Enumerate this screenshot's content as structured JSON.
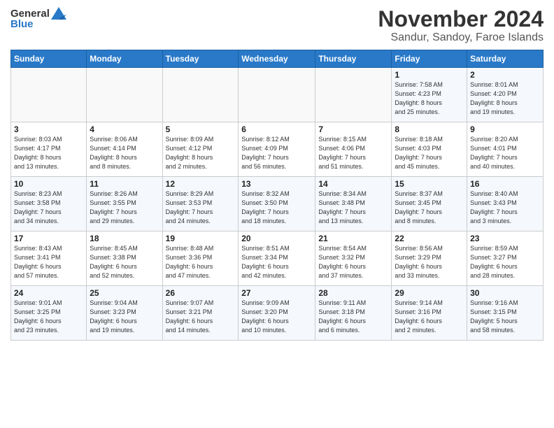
{
  "header": {
    "logo_general": "General",
    "logo_blue": "Blue",
    "month_title": "November 2024",
    "location": "Sandur, Sandoy, Faroe Islands"
  },
  "calendar": {
    "days_of_week": [
      "Sunday",
      "Monday",
      "Tuesday",
      "Wednesday",
      "Thursday",
      "Friday",
      "Saturday"
    ],
    "weeks": [
      [
        {
          "date": "",
          "info": ""
        },
        {
          "date": "",
          "info": ""
        },
        {
          "date": "",
          "info": ""
        },
        {
          "date": "",
          "info": ""
        },
        {
          "date": "",
          "info": ""
        },
        {
          "date": "1",
          "info": "Sunrise: 7:58 AM\nSunset: 4:23 PM\nDaylight: 8 hours\nand 25 minutes."
        },
        {
          "date": "2",
          "info": "Sunrise: 8:01 AM\nSunset: 4:20 PM\nDaylight: 8 hours\nand 19 minutes."
        }
      ],
      [
        {
          "date": "3",
          "info": "Sunrise: 8:03 AM\nSunset: 4:17 PM\nDaylight: 8 hours\nand 13 minutes."
        },
        {
          "date": "4",
          "info": "Sunrise: 8:06 AM\nSunset: 4:14 PM\nDaylight: 8 hours\nand 8 minutes."
        },
        {
          "date": "5",
          "info": "Sunrise: 8:09 AM\nSunset: 4:12 PM\nDaylight: 8 hours\nand 2 minutes."
        },
        {
          "date": "6",
          "info": "Sunrise: 8:12 AM\nSunset: 4:09 PM\nDaylight: 7 hours\nand 56 minutes."
        },
        {
          "date": "7",
          "info": "Sunrise: 8:15 AM\nSunset: 4:06 PM\nDaylight: 7 hours\nand 51 minutes."
        },
        {
          "date": "8",
          "info": "Sunrise: 8:18 AM\nSunset: 4:03 PM\nDaylight: 7 hours\nand 45 minutes."
        },
        {
          "date": "9",
          "info": "Sunrise: 8:20 AM\nSunset: 4:01 PM\nDaylight: 7 hours\nand 40 minutes."
        }
      ],
      [
        {
          "date": "10",
          "info": "Sunrise: 8:23 AM\nSunset: 3:58 PM\nDaylight: 7 hours\nand 34 minutes."
        },
        {
          "date": "11",
          "info": "Sunrise: 8:26 AM\nSunset: 3:55 PM\nDaylight: 7 hours\nand 29 minutes."
        },
        {
          "date": "12",
          "info": "Sunrise: 8:29 AM\nSunset: 3:53 PM\nDaylight: 7 hours\nand 24 minutes."
        },
        {
          "date": "13",
          "info": "Sunrise: 8:32 AM\nSunset: 3:50 PM\nDaylight: 7 hours\nand 18 minutes."
        },
        {
          "date": "14",
          "info": "Sunrise: 8:34 AM\nSunset: 3:48 PM\nDaylight: 7 hours\nand 13 minutes."
        },
        {
          "date": "15",
          "info": "Sunrise: 8:37 AM\nSunset: 3:45 PM\nDaylight: 7 hours\nand 8 minutes."
        },
        {
          "date": "16",
          "info": "Sunrise: 8:40 AM\nSunset: 3:43 PM\nDaylight: 7 hours\nand 3 minutes."
        }
      ],
      [
        {
          "date": "17",
          "info": "Sunrise: 8:43 AM\nSunset: 3:41 PM\nDaylight: 6 hours\nand 57 minutes."
        },
        {
          "date": "18",
          "info": "Sunrise: 8:45 AM\nSunset: 3:38 PM\nDaylight: 6 hours\nand 52 minutes."
        },
        {
          "date": "19",
          "info": "Sunrise: 8:48 AM\nSunset: 3:36 PM\nDaylight: 6 hours\nand 47 minutes."
        },
        {
          "date": "20",
          "info": "Sunrise: 8:51 AM\nSunset: 3:34 PM\nDaylight: 6 hours\nand 42 minutes."
        },
        {
          "date": "21",
          "info": "Sunrise: 8:54 AM\nSunset: 3:32 PM\nDaylight: 6 hours\nand 37 minutes."
        },
        {
          "date": "22",
          "info": "Sunrise: 8:56 AM\nSunset: 3:29 PM\nDaylight: 6 hours\nand 33 minutes."
        },
        {
          "date": "23",
          "info": "Sunrise: 8:59 AM\nSunset: 3:27 PM\nDaylight: 6 hours\nand 28 minutes."
        }
      ],
      [
        {
          "date": "24",
          "info": "Sunrise: 9:01 AM\nSunset: 3:25 PM\nDaylight: 6 hours\nand 23 minutes."
        },
        {
          "date": "25",
          "info": "Sunrise: 9:04 AM\nSunset: 3:23 PM\nDaylight: 6 hours\nand 19 minutes."
        },
        {
          "date": "26",
          "info": "Sunrise: 9:07 AM\nSunset: 3:21 PM\nDaylight: 6 hours\nand 14 minutes."
        },
        {
          "date": "27",
          "info": "Sunrise: 9:09 AM\nSunset: 3:20 PM\nDaylight: 6 hours\nand 10 minutes."
        },
        {
          "date": "28",
          "info": "Sunrise: 9:11 AM\nSunset: 3:18 PM\nDaylight: 6 hours\nand 6 minutes."
        },
        {
          "date": "29",
          "info": "Sunrise: 9:14 AM\nSunset: 3:16 PM\nDaylight: 6 hours\nand 2 minutes."
        },
        {
          "date": "30",
          "info": "Sunrise: 9:16 AM\nSunset: 3:15 PM\nDaylight: 5 hours\nand 58 minutes."
        }
      ]
    ]
  }
}
